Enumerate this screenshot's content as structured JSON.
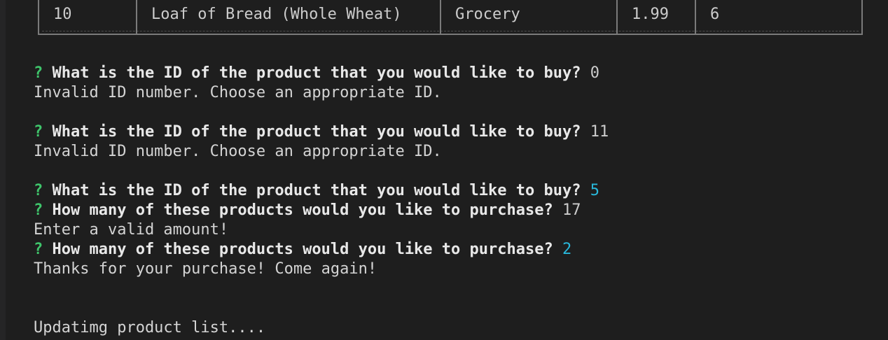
{
  "table": {
    "row": {
      "id": "10",
      "name": "Loaf of Bread (Whole Wheat)",
      "department": "Grocery",
      "price": "1.99",
      "quantity": "6"
    }
  },
  "transcript": [
    {
      "type": "prompt",
      "mark": "?",
      "question": "What is the ID of the product that you would like to buy?",
      "answer": "0",
      "answer_color": "plain"
    },
    {
      "type": "message",
      "text": "Invalid ID number. Choose an appropriate ID."
    },
    {
      "type": "prompt",
      "mark": "?",
      "question": "What is the ID of the product that you would like to buy?",
      "answer": "11",
      "answer_color": "plain"
    },
    {
      "type": "message",
      "text": "Invalid ID number. Choose an appropriate ID."
    },
    {
      "type": "prompt",
      "mark": "?",
      "question": "What is the ID of the product that you would like to buy?",
      "answer": "5",
      "answer_color": "cyan"
    },
    {
      "type": "prompt",
      "mark": "?",
      "question": "How many of these products would you like to purchase?",
      "answer": "17",
      "answer_color": "plain"
    },
    {
      "type": "message",
      "text": "Enter a valid amount!"
    },
    {
      "type": "prompt",
      "mark": "?",
      "question": "How many of these products would you like to purchase?",
      "answer": "2",
      "answer_color": "cyan"
    },
    {
      "type": "message",
      "text": "Thanks for your purchase! Come again!"
    },
    {
      "type": "message",
      "text": "Updatimg product list...."
    }
  ],
  "colors": {
    "background": "#1e1e1e",
    "prompt_mark": "#3fc56b",
    "answer_accent": "#29b8db",
    "text": "#cccccc"
  }
}
